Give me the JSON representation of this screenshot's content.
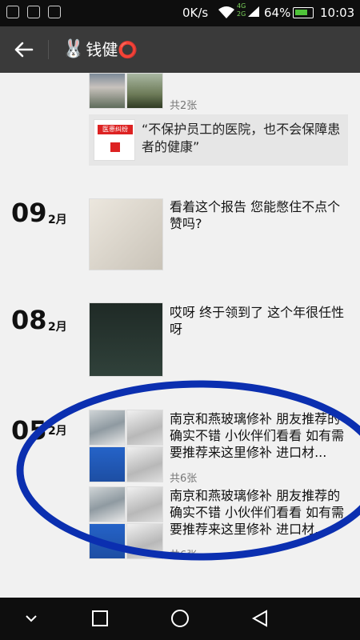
{
  "status_bar": {
    "speed": "0K/s",
    "network": "4G\n2G",
    "battery": "64%",
    "time": "10:03"
  },
  "header": {
    "avatar": "🐰",
    "title": "钱健⭕",
    "back_icon": "arrow-left"
  },
  "posts": [
    {
      "count": "共2张"
    },
    {
      "share_text": "“不保护员工的医院，也不会保障患者的健康”",
      "share_thumb_title": "医患纠纷"
    },
    {
      "day": "09",
      "month": "2月",
      "text": "看着这个报告 您能憋住不点个赞吗?"
    },
    {
      "day": "08",
      "month": "2月",
      "text": "哎呀 终于领到了 这个年很任性呀"
    },
    {
      "day": "05",
      "month": "2月",
      "text": "南京和燕玻璃修补 朋友推荐的确实不错 小伙伴们看看 如有需要推荐来这里修补 进口材...",
      "count": "共6张"
    },
    {
      "text": "南京和燕玻璃修补 朋友推荐的确实不错 小伙伴们看看 如有需要推荐来这里修补 进口材...",
      "count": "共6张"
    }
  ],
  "colors": {
    "header_bg": "#3a3a3a",
    "annotation": "#0b2fb0"
  }
}
